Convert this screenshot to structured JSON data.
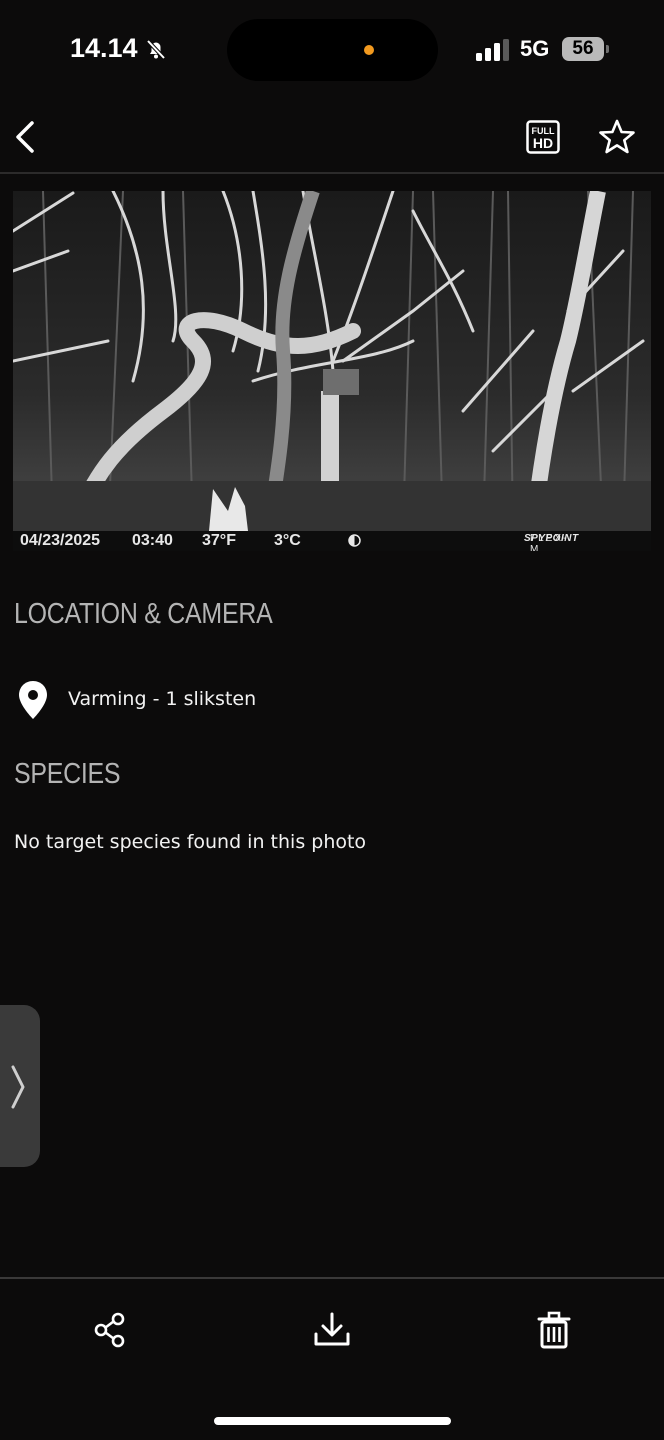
{
  "status_bar": {
    "time": "14.14",
    "network": "5G",
    "battery": "56",
    "colors": {
      "privacy_dot": "#f29a1f"
    }
  },
  "header": {
    "icons": [
      "chevron-left-icon",
      "full-hd-icon",
      "star-icon"
    ],
    "hd_badge_top": "FULL",
    "hd_badge_bottom": "HD"
  },
  "photo": {
    "date": "04/23/2025",
    "time": "03:40",
    "temp_f": "37°F",
    "temp_c": "3°C",
    "brand": "SPYPOINT",
    "model": "FLEX-M"
  },
  "location_section": {
    "title": "LOCATION & CAMERA",
    "location": "Varming - 1 sliksten"
  },
  "species_section": {
    "title": "SPECIES",
    "message": "No target species found in this photo"
  },
  "toolbar": {
    "icons": [
      "share-icon",
      "download-icon",
      "trash-icon"
    ]
  }
}
